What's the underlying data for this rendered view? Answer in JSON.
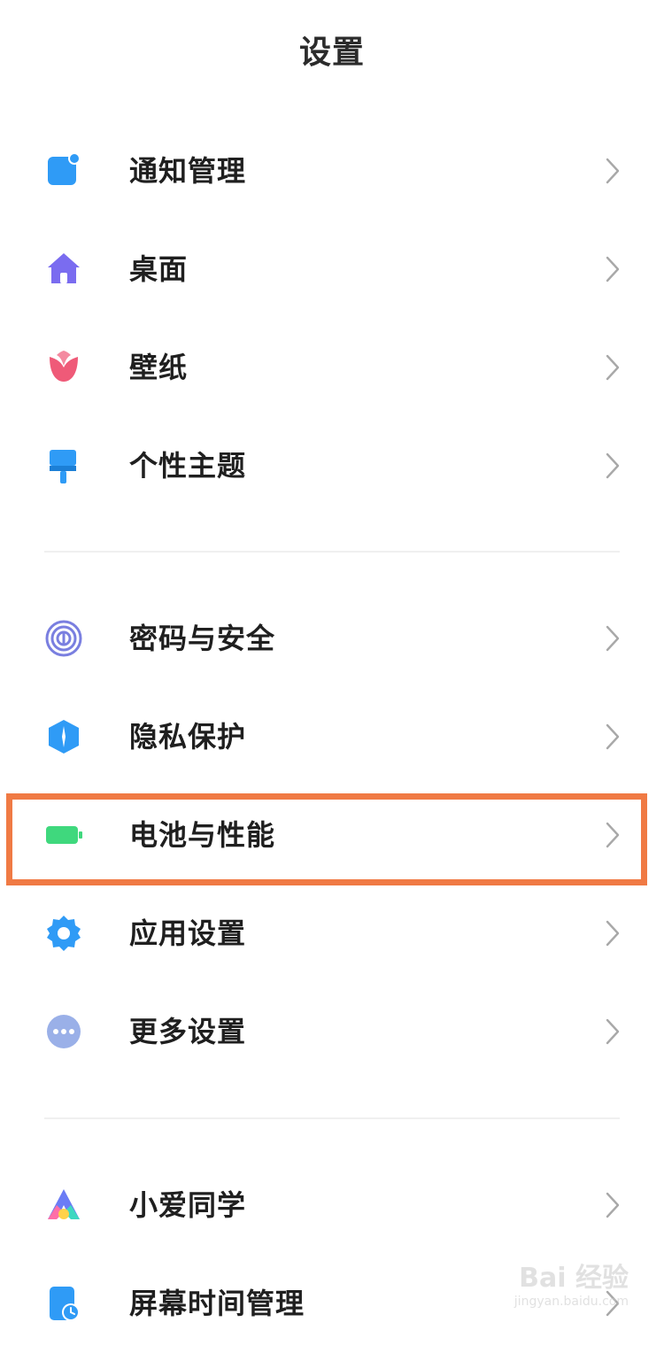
{
  "header": {
    "title": "设置"
  },
  "groups": [
    {
      "items": [
        {
          "label": "通知管理",
          "icon": "notification-icon",
          "color": "#2f9bf6"
        },
        {
          "label": "桌面",
          "icon": "home-icon",
          "color": "#7a6cf0"
        },
        {
          "label": "壁纸",
          "icon": "tulip-icon",
          "color": "#ef5a78"
        },
        {
          "label": "个性主题",
          "icon": "paint-brush-icon",
          "color": "#2f9bf6"
        }
      ]
    },
    {
      "items": [
        {
          "label": "密码与安全",
          "icon": "fingerprint-icon",
          "color": "#7a7fe0"
        },
        {
          "label": "隐私保护",
          "icon": "shield-icon",
          "color": "#2f9bf6"
        },
        {
          "label": "电池与性能",
          "icon": "battery-icon",
          "color": "#3fd87d",
          "highlighted": true
        },
        {
          "label": "应用设置",
          "icon": "gear-icon",
          "color": "#2f9bf6"
        },
        {
          "label": "更多设置",
          "icon": "more-icon",
          "color": "#9ab0e8"
        }
      ]
    },
    {
      "items": [
        {
          "label": "小爱同学",
          "icon": "xiaoai-icon",
          "color": "#6b7cf5"
        },
        {
          "label": "屏幕时间管理",
          "icon": "screen-time-icon",
          "color": "#2f9bf6"
        }
      ]
    }
  ],
  "highlight": {
    "color": "#f07a44"
  },
  "watermark": {
    "logo": "Bai 经验",
    "url": "jingyan.baidu.com"
  }
}
